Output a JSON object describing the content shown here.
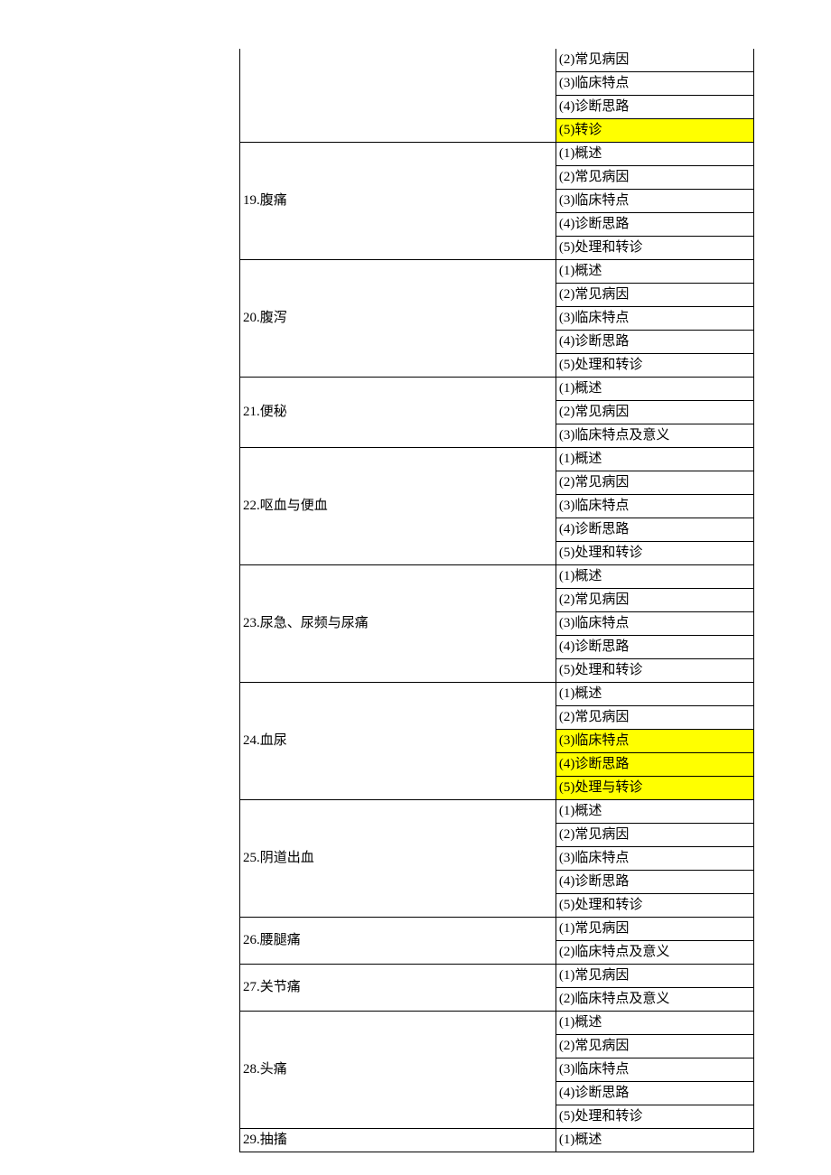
{
  "rows": [
    {
      "left": "",
      "rights": [
        "(2)常见病因",
        "(3)临床特点",
        "(4)诊断思路",
        {
          "t": "(5)转诊",
          "hl": true
        }
      ]
    },
    {
      "left": "19.腹痛",
      "rights": [
        "(1)概述",
        "(2)常见病因",
        "(3)临床特点",
        "(4)诊断思路",
        "(5)处理和转诊"
      ]
    },
    {
      "left": "20.腹泻",
      "rights": [
        "(1)概述",
        "(2)常见病因",
        "(3)临床特点",
        "(4)诊断思路",
        "(5)处理和转诊"
      ]
    },
    {
      "left": "21.便秘",
      "rights": [
        "(1)概述",
        "(2)常见病因",
        "(3)临床特点及意义"
      ]
    },
    {
      "left": "22.呕血与便血",
      "rights": [
        "(1)概述",
        "(2)常见病因",
        "(3)临床特点",
        "(4)诊断思路",
        "(5)处理和转诊"
      ]
    },
    {
      "left": "23.尿急、尿频与尿痛",
      "rights": [
        "(1)概述",
        "(2)常见病因",
        "(3)临床特点",
        "(4)诊断思路",
        "(5)处理和转诊"
      ]
    },
    {
      "left": "24.血尿",
      "rights": [
        "(1)概述",
        "(2)常见病因",
        {
          "t": "(3)临床特点",
          "hl": true
        },
        {
          "t": "(4)诊断思路",
          "hl": true
        },
        {
          "t": "(5)处理与转诊",
          "hl": true
        }
      ]
    },
    {
      "left": "25.阴道出血",
      "rights": [
        "(1)概述",
        "(2)常见病因",
        "(3)临床特点",
        "(4)诊断思路",
        "(5)处理和转诊"
      ]
    },
    {
      "left": "26.腰腿痛",
      "rights": [
        "(1)常见病因",
        "(2)临床特点及意义"
      ]
    },
    {
      "left": "27.关节痛",
      "rights": [
        "(1)常见病因",
        "(2)临床特点及意义"
      ]
    },
    {
      "left": "28.头痛",
      "rights": [
        "(1)概述",
        "(2)常见病因",
        "(3)临床特点",
        "(4)诊断思路",
        "(5)处理和转诊"
      ]
    },
    {
      "left": "29.抽搐",
      "rights": [
        "(1)概述"
      ]
    }
  ]
}
